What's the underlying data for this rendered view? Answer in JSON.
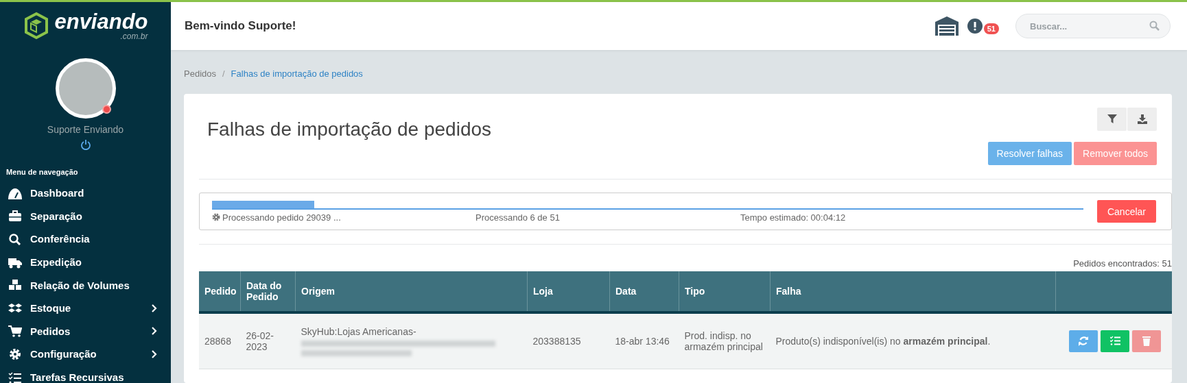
{
  "brand": {
    "name": "enviando",
    "domain": ".com.br"
  },
  "user": {
    "name": "Suporte Enviando"
  },
  "nav": {
    "heading": "Menu de navegação",
    "items": [
      {
        "label": "Dashboard",
        "kind": "gauge",
        "submenu": false
      },
      {
        "label": "Separação",
        "kind": "briefcase",
        "submenu": false
      },
      {
        "label": "Conferência",
        "kind": "search",
        "submenu": false
      },
      {
        "label": "Expedição",
        "kind": "truck",
        "submenu": false
      },
      {
        "label": "Relação de Volumes",
        "kind": "cubes",
        "submenu": false
      },
      {
        "label": "Estoque",
        "kind": "boxes",
        "submenu": true
      },
      {
        "label": "Pedidos",
        "kind": "cart",
        "submenu": true
      },
      {
        "label": "Configuração",
        "kind": "gear",
        "submenu": true
      },
      {
        "label": "Tarefas Recursivas",
        "kind": "tasks",
        "submenu": false
      }
    ]
  },
  "header": {
    "greeting": "Bem-vindo Suporte!",
    "alerts_count": "51",
    "search": {
      "placeholder": "Buscar..."
    }
  },
  "breadcrumb_separator": "/",
  "breadcrumb": [
    {
      "label": "Pedidos",
      "current": false
    },
    {
      "label": "Falhas de importação de pedidos",
      "current": true
    }
  ],
  "page": {
    "title": "Falhas de importação de pedidos",
    "actions": [
      {
        "label": "Resolver falhas",
        "kind": "primary",
        "disabled": true
      },
      {
        "label": "Remover todos",
        "kind": "danger",
        "disabled": true
      }
    ]
  },
  "progress": {
    "level": 0.117,
    "status": "Processando pedido 29039 ...",
    "count": "Processando 6 de 51",
    "eta": "Tempo estimado: 00:04:12",
    "cancel": "Cancelar"
  },
  "table": {
    "found": "Pedidos encontrados: 51",
    "columns": [
      "Pedido",
      "Data do Pedido",
      "Origem",
      "Loja",
      "Data",
      "Tipo",
      "Falha"
    ],
    "rows": [
      {
        "cells": [
          "28868",
          "26-02-2023",
          "SkyHub:Lojas Americanas-",
          "203388135",
          "18-abr 13:46",
          "Prod. indisp. no armazém principal",
          "Produto(s) indisponível(is) no **armazém principal**."
        ],
        "origin_blurred": true,
        "buttons": [
          {
            "kind": "refresh",
            "disabled": false
          },
          {
            "kind": "list",
            "disabled": false
          },
          {
            "kind": "trash",
            "disabled": true
          }
        ]
      }
    ]
  }
}
